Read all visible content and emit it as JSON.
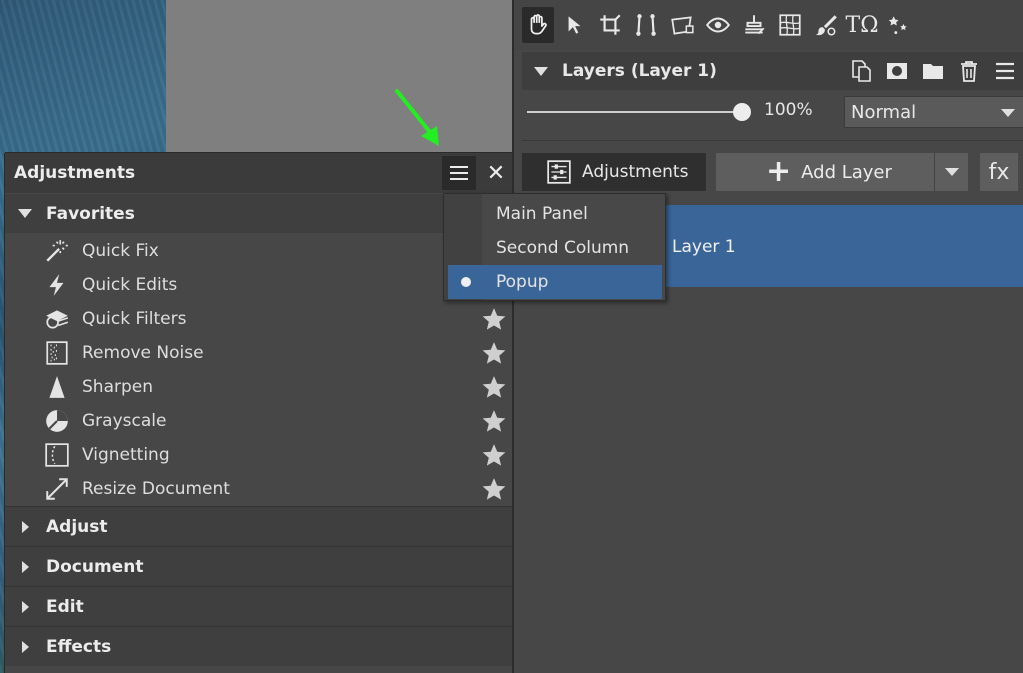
{
  "colors": {
    "accent_selected": "#3a6599",
    "arrow": "#22ee22"
  },
  "toolbar": {
    "tools": [
      "hand-icon",
      "pointer-icon",
      "crop-icon",
      "straighten-icon",
      "perspective-icon",
      "eye-icon",
      "clone-icon",
      "grid-icon",
      "brush-icon",
      "text-icon",
      "effects-icon"
    ],
    "text_tool_label": "TΩ"
  },
  "layers": {
    "title": "Layers (Layer 1)",
    "opacity": {
      "value": "100%",
      "level": 1.0
    },
    "blend_mode": "Normal",
    "adjustments_button": "Adjustments",
    "add_layer_button": "Add Layer",
    "fx_button": "fx",
    "items": [
      {
        "name": "Layer 1",
        "selected": true
      }
    ]
  },
  "adjustments": {
    "title": "Adjustments",
    "close_label": "✕",
    "favorites": {
      "label": "Favorites",
      "items": [
        {
          "label": "Quick Fix",
          "icon": "magic-wand-icon"
        },
        {
          "label": "Quick Edits",
          "icon": "lightning-icon"
        },
        {
          "label": "Quick Filters",
          "icon": "filters-icon"
        },
        {
          "label": "Remove Noise",
          "icon": "noise-icon"
        },
        {
          "label": "Sharpen",
          "icon": "sharpen-icon"
        },
        {
          "label": "Grayscale",
          "icon": "grayscale-icon"
        },
        {
          "label": "Vignetting",
          "icon": "vignetting-icon"
        },
        {
          "label": "Resize Document",
          "icon": "resize-icon"
        }
      ]
    },
    "sections": [
      {
        "label": "Adjust"
      },
      {
        "label": "Document"
      },
      {
        "label": "Edit"
      },
      {
        "label": "Effects"
      }
    ]
  },
  "panel_menu": {
    "items": [
      {
        "label": "Main Panel",
        "selected": false
      },
      {
        "label": "Second Column",
        "selected": false
      },
      {
        "label": "Popup",
        "selected": true
      }
    ]
  }
}
